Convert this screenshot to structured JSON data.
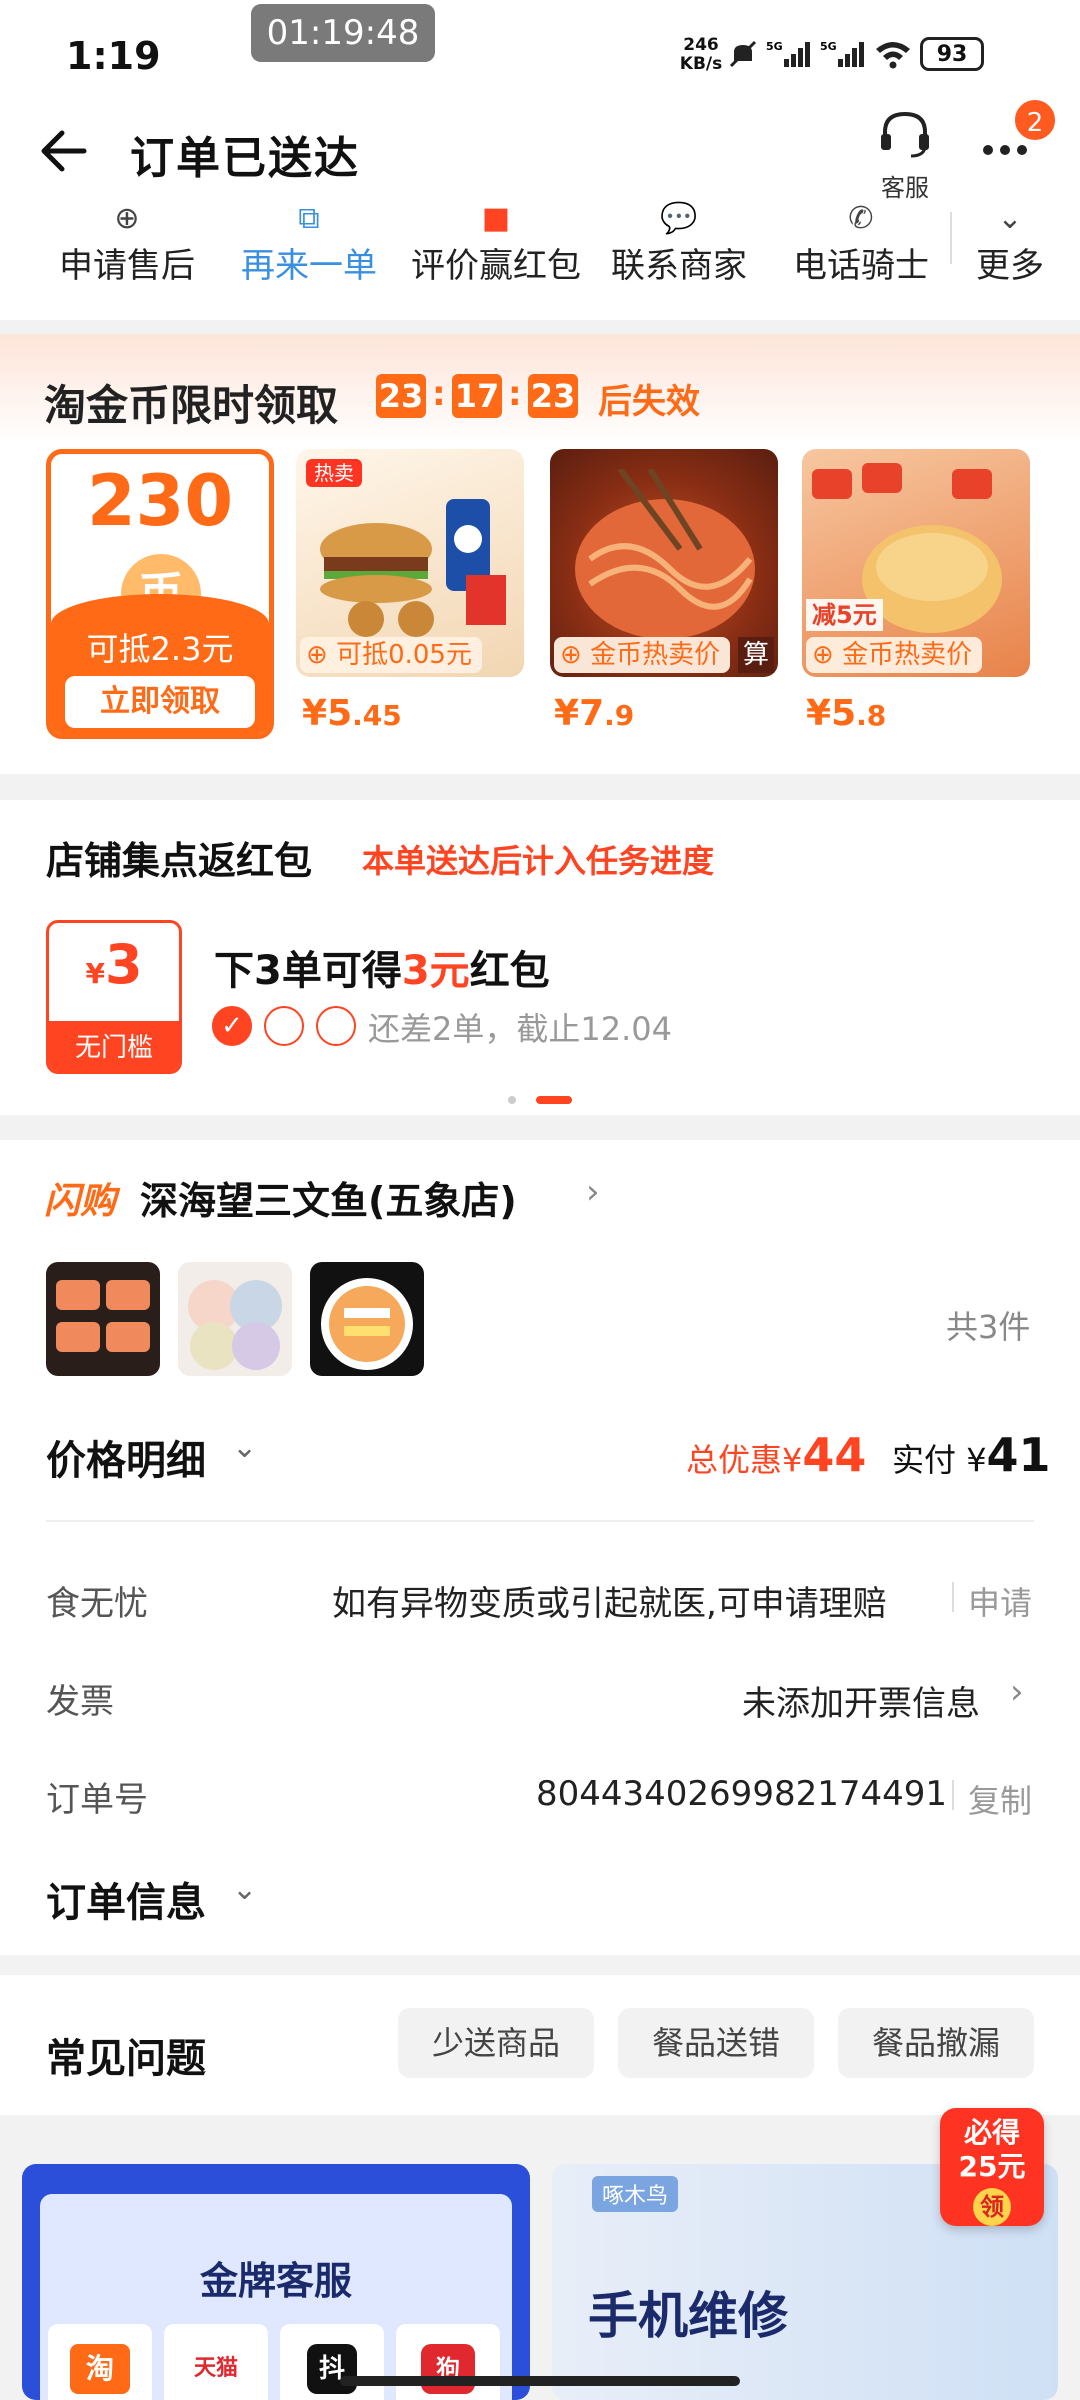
{
  "status": {
    "time": "1:19",
    "recording_time": "01:19:48",
    "net_speed_value": "246",
    "net_speed_unit": "KB/s",
    "battery": "93",
    "icons": [
      "mute-icon",
      "signal-5g-icon",
      "signal-5g-icon",
      "wifi-icon"
    ]
  },
  "header": {
    "title": "订单已送达",
    "service_label": "客服",
    "badge_count": "2"
  },
  "actions": [
    {
      "label": "申请售后",
      "icon": "after-sale-icon"
    },
    {
      "label": "再来一单",
      "icon": "reorder-icon"
    },
    {
      "label": "评价赢红包",
      "icon": "red-packet-icon"
    },
    {
      "label": "联系商家",
      "icon": "chat-icon"
    },
    {
      "label": "电话骑士",
      "icon": "phone-icon"
    },
    {
      "label": "更多",
      "icon": "chevron-down-icon"
    }
  ],
  "coin_section": {
    "title": "淘金币限时领取",
    "timer": [
      "23",
      "17",
      "23"
    ],
    "timer_suffix": "后失效",
    "coin_amount": "230",
    "coin_offset": "可抵2.3元",
    "claim_label": "立即领取",
    "coin_symbol": "币",
    "products": [
      {
        "tag": "可抵0.05元",
        "price_int": "5",
        "price_dec": ".45",
        "corner": "热卖"
      },
      {
        "tag": "金币热卖价",
        "price_int": "7",
        "price_dec": ".9",
        "corner": "算"
      },
      {
        "tag": "金币热卖价",
        "price_int": "5",
        "price_dec": ".8",
        "corner": "减5元"
      }
    ],
    "currency": "¥"
  },
  "stamp_section": {
    "title": "店铺集点返红包",
    "subtitle": "本单送达后计入任务进度",
    "coupon_value": "3",
    "coupon_currency": "¥",
    "coupon_foot": "无门槛",
    "task_pre": "下3单可得",
    "task_amount": "3元",
    "task_post": "红包",
    "check_mark": "✓",
    "remain": "还差2单，截止12.04"
  },
  "store": {
    "flash_tag": "闪购",
    "name": "深海望三文鱼(五象店)",
    "item_count": "共3件",
    "price_detail_label": "价格明细",
    "discount_label": "总优惠",
    "discount_currency": "¥",
    "discount_value": "44",
    "paid_label": "实付",
    "paid_currency": "¥",
    "paid_value": "41",
    "rows": [
      {
        "label": "食无忧",
        "value": "如有异物变质或引起就医,可申请理赔",
        "action": "申请"
      },
      {
        "label": "发票",
        "value": "未添加开票信息",
        "action": ""
      },
      {
        "label": "订单号",
        "value": "804434026998217449​1",
        "action": "复制"
      }
    ],
    "order_info_label": "订单信息"
  },
  "faq": {
    "title": "常见问题",
    "chips": [
      "少送商品",
      "餐品送错",
      "餐品撤漏"
    ]
  },
  "banners": {
    "left_title": "金牌客服",
    "app_tiles": [
      "淘",
      "天猫",
      "抖",
      "狗"
    ],
    "right_title": "手机维修",
    "right_logo": "啄木鸟",
    "float_line1": "必得",
    "float_line2": "25元",
    "float_btn": "领"
  },
  "colors": {
    "accent_orange": "#ff6a17",
    "accent_red": "#ff4422",
    "link_blue": "#3a8fe0"
  }
}
